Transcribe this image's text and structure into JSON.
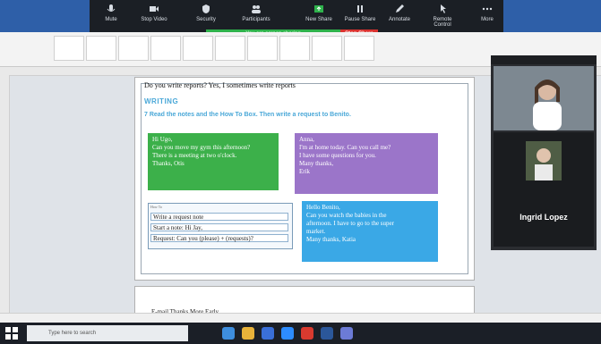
{
  "zoom": {
    "buttons": [
      {
        "label": "Mute",
        "icon": "microphone-icon"
      },
      {
        "label": "Stop Video",
        "icon": "video-camera-icon"
      },
      {
        "label": "Security",
        "icon": "shield-icon"
      },
      {
        "label": "Participants",
        "icon": "participants-icon",
        "count": "2"
      },
      {
        "label": "New Share",
        "icon": "share-screen-icon"
      },
      {
        "label": "Pause Share",
        "icon": "pause-icon"
      },
      {
        "label": "Annotate",
        "icon": "pencil-icon"
      },
      {
        "label": "Remote Control",
        "icon": "remote-control-icon"
      },
      {
        "label": "More",
        "icon": "more-icon"
      }
    ],
    "share_banner": "You are screen sharing",
    "stop_share": "Stop Share"
  },
  "document": {
    "line1": "Do you write reports? Yes, I sometimes write reports",
    "writing_heading": "WRITING",
    "instruction": "7 Read the notes and the How To Box. Then write a request to Benito.",
    "note_green": [
      "Hi Ugo,",
      "Can you move my gym this afternoon?",
      "There is a meeting at two o'clock.",
      "Thanks, Otis"
    ],
    "note_purple": [
      "Anna,",
      "I'm at home today. Can you call me?",
      "I have some questions for you.",
      "Many thanks,",
      "Erik"
    ],
    "note_blue": [
      "Hello Benito,",
      "Can you watch the babies in the",
      "afternoon. I have to go to the super",
      "market.",
      "Many thanks, Katia"
    ],
    "howto_title": "How To",
    "howto_rows": [
      "Write a request note",
      "Start a note: Hi Jay,",
      "Request: Can you (please) + (requests)?"
    ],
    "page2_text": "E-mail  Thanks  More  Early  ..."
  },
  "video": {
    "participant_name": "Ingrid Lopez"
  },
  "taskbar": {
    "search_placeholder": "Type here to search"
  }
}
